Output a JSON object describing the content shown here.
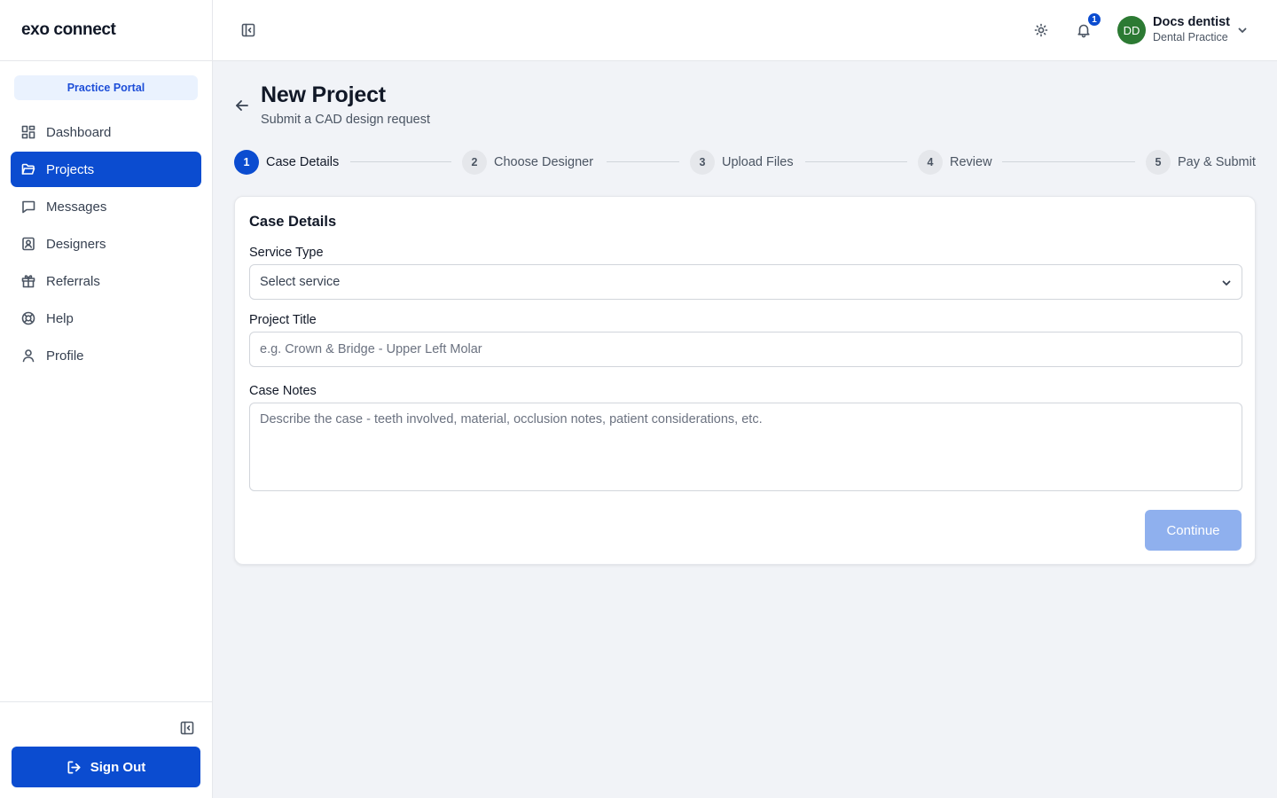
{
  "app": {
    "logo": "exo connect",
    "portal_badge": "Practice Portal"
  },
  "sidebar": {
    "items": [
      {
        "label": "Dashboard",
        "icon": "dashboard-icon"
      },
      {
        "label": "Projects",
        "icon": "folder-icon",
        "active": true
      },
      {
        "label": "Messages",
        "icon": "message-icon"
      },
      {
        "label": "Designers",
        "icon": "designer-icon"
      },
      {
        "label": "Referrals",
        "icon": "gift-icon"
      },
      {
        "label": "Help",
        "icon": "help-icon"
      },
      {
        "label": "Profile",
        "icon": "user-icon"
      }
    ],
    "signout_label": "Sign Out"
  },
  "topbar": {
    "notification_count": "1",
    "user": {
      "initials": "DD",
      "name": "Docs dentist",
      "role": "Dental Practice"
    }
  },
  "header": {
    "title": "New Project",
    "subtitle": "Submit a CAD design request"
  },
  "stepper": {
    "steps": [
      {
        "number": "1",
        "label": "Case Details",
        "active": true
      },
      {
        "number": "2",
        "label": "Choose Designer"
      },
      {
        "number": "3",
        "label": "Upload Files"
      },
      {
        "number": "4",
        "label": "Review"
      },
      {
        "number": "5",
        "label": "Pay & Submit"
      }
    ]
  },
  "form": {
    "title": "Case Details",
    "service_type": {
      "label": "Service Type",
      "value": "Select service"
    },
    "project_title": {
      "label": "Project Title",
      "placeholder": "e.g. Crown & Bridge - Upper Left Molar",
      "value": ""
    },
    "case_notes": {
      "label": "Case Notes",
      "placeholder": "Describe the case - teeth involved, material, occlusion notes, patient considerations, etc.",
      "value": ""
    },
    "continue_label": "Continue"
  },
  "colors": {
    "primary": "#0b4cd0",
    "avatar": "#2c7a33",
    "continue_disabled": "#8fb0ee"
  }
}
